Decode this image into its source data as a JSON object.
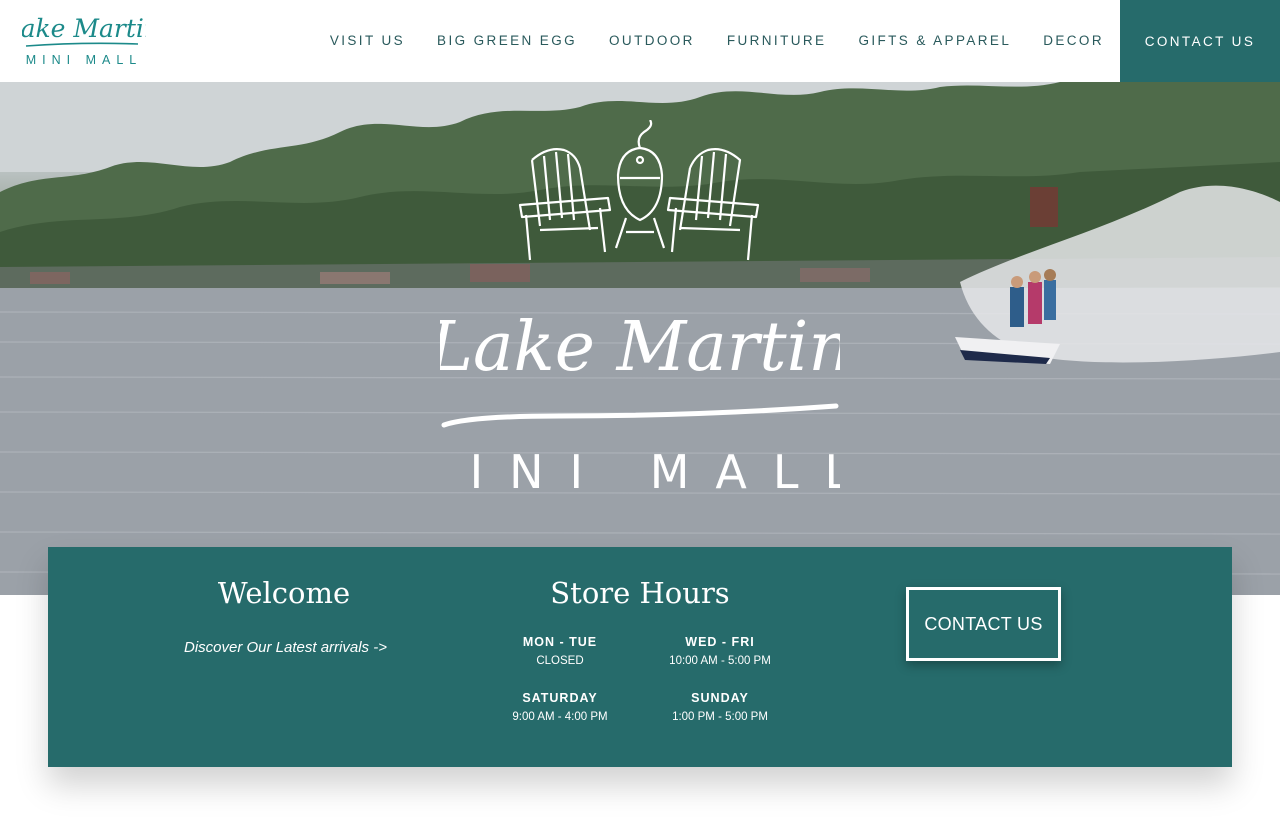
{
  "brand": {
    "logo_line1": "Lake Martin",
    "logo_line2": "MINI MALL",
    "teal": "#266b6b"
  },
  "nav": {
    "items": [
      {
        "label": "VISIT US"
      },
      {
        "label": "BIG GREEN EGG"
      },
      {
        "label": "OUTDOOR"
      },
      {
        "label": "FURNITURE"
      },
      {
        "label": "GIFTS & APPAREL"
      },
      {
        "label": "DECOR"
      }
    ],
    "contact_label": "CONTACT US"
  },
  "hero": {
    "title_script": "Lake Martin",
    "title_sub": "MINI MALL"
  },
  "welcome": {
    "title": "Welcome",
    "link_text": "Discover Our Latest arrivals ->"
  },
  "hours": {
    "title": "Store Hours",
    "days": [
      {
        "label": "MON - TUE",
        "value": "CLOSED"
      },
      {
        "label": "WED - FRI",
        "value": "10:00 AM - 5:00 PM"
      },
      {
        "label": "SATURDAY",
        "value": "9:00 AM - 4:00 PM"
      },
      {
        "label": "SUNDAY",
        "value": "1:00 PM - 5:00 PM"
      }
    ]
  },
  "cta": {
    "label": "CONTACT US"
  }
}
